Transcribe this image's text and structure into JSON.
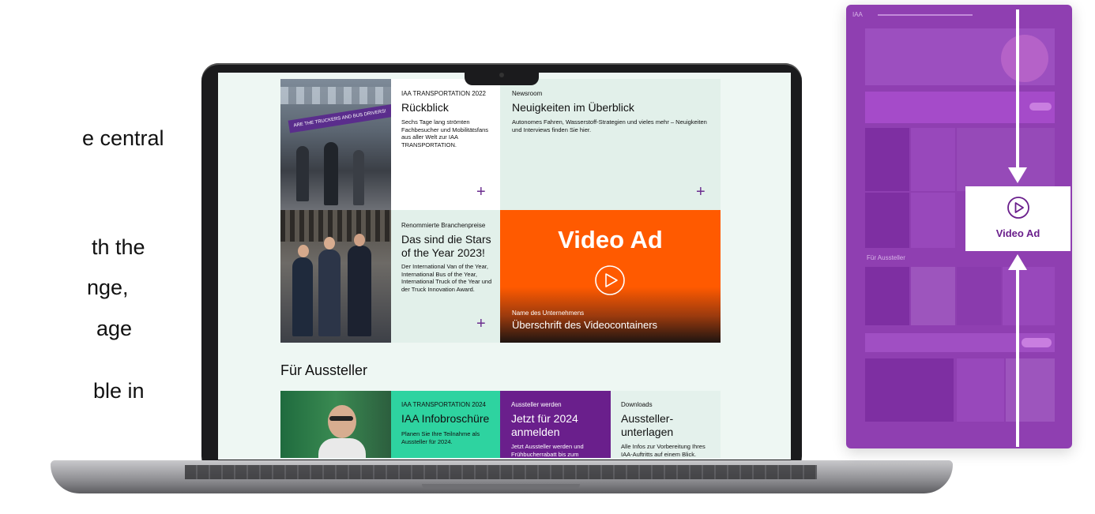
{
  "slide_text": [
    "e central",
    "th the",
    "nge,",
    "age",
    "ble in"
  ],
  "tiles": {
    "rueckblick": {
      "eyebrow": "IAA TRANSPORTATION 2022",
      "title": "Rückblick",
      "desc": "Sechs Tage lang strömten Fachbesucher und Mobilitätsfans aus aller Welt zur IAA TRANSPORTATION.",
      "photo_banner": "ARE THE TRUCKERS AND BUS DRIVERS!"
    },
    "newsroom": {
      "eyebrow": "Newsroom",
      "title": "Neuigkeiten im Überblick",
      "desc": "Autonomes Fahren, Wasserstoff-Strategien und vieles mehr – Neuigkeiten und Interviews finden Sie hier."
    },
    "stars": {
      "eyebrow": "Renommierte Branchenpreise",
      "title": "Das sind die Stars of the Year 2023!",
      "desc": "Der International Van of the Year, International Bus of the Year, International Truck of the Year und der Truck Innovation Award."
    },
    "video": {
      "title": "Video Ad",
      "company": "Name des Unternehmens",
      "heading": "Überschrift des Videocontainers",
      "color": "#ff5a00"
    }
  },
  "section_heading": "Für Aussteller",
  "aussteller": [
    {
      "eyebrow": "IAA TRANSPORTATION 2024",
      "title": "IAA Infobroschüre",
      "desc": "Planen Sie Ihre Teilnahme als Aussteller für 2024.",
      "color": "#2ed3a0"
    },
    {
      "eyebrow": "Aussteller werden",
      "title": "Jetzt für 2024 anmelden",
      "desc": "Jetzt Aussteller werden und Frühbucherrabatt bis zum",
      "color": "#6a1f8c"
    },
    {
      "eyebrow": "Downloads",
      "title": "Aussteller-unterlagen",
      "desc": "Alle Infos zur Vorbereitung Ihres IAA-Auftritts auf einem Blick.",
      "color": "#e4f1ec"
    }
  ],
  "plus_symbol": "+",
  "preview": {
    "logo": "IAA",
    "video_label": "Video Ad",
    "section_label": "Für Aussteller",
    "color": "#8f3fb1"
  }
}
